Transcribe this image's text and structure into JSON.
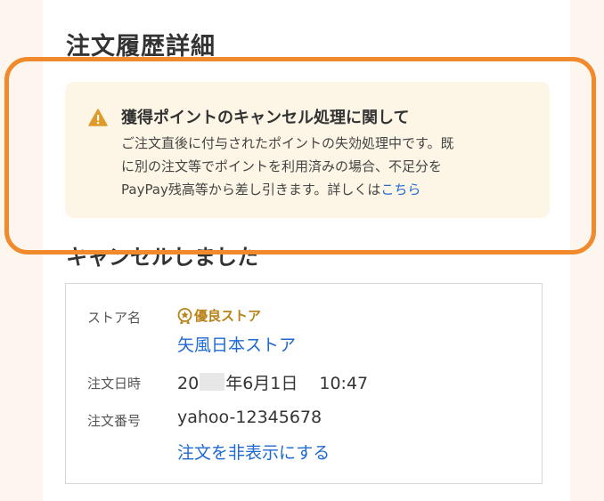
{
  "page": {
    "title": "注文履歴詳細"
  },
  "notice": {
    "icon": "warning-icon",
    "title": "獲得ポイントのキャンセル処理に関して",
    "body_line1": "ご注文直後に付与されたポイントの失効処理中です。既",
    "body_line2": "に別の注文等でポイントを利用済みの場合、不足分を",
    "body_line3": "PayPay残高等から差し引きます。詳しくは",
    "link_label": "こちら"
  },
  "status": {
    "heading": "キャンセルしました"
  },
  "details": {
    "store_label": "ストア名",
    "store_badge": "優良ストア",
    "store_name": "矢風日本ストア",
    "date_label": "注文日時",
    "date_prefix": "20",
    "date_suffix": "年6月1日",
    "time": "10:47",
    "order_no_label": "注文番号",
    "order_no": "yahoo-12345678",
    "hide_order_link": "注文を非表示にする"
  },
  "colors": {
    "background": "#fcf6ee",
    "notice_background": "#fdf6e6",
    "warning": "#e09a2a",
    "link": "#1f6ad0",
    "badge": "#b88218",
    "highlight": "#f08a2c"
  }
}
